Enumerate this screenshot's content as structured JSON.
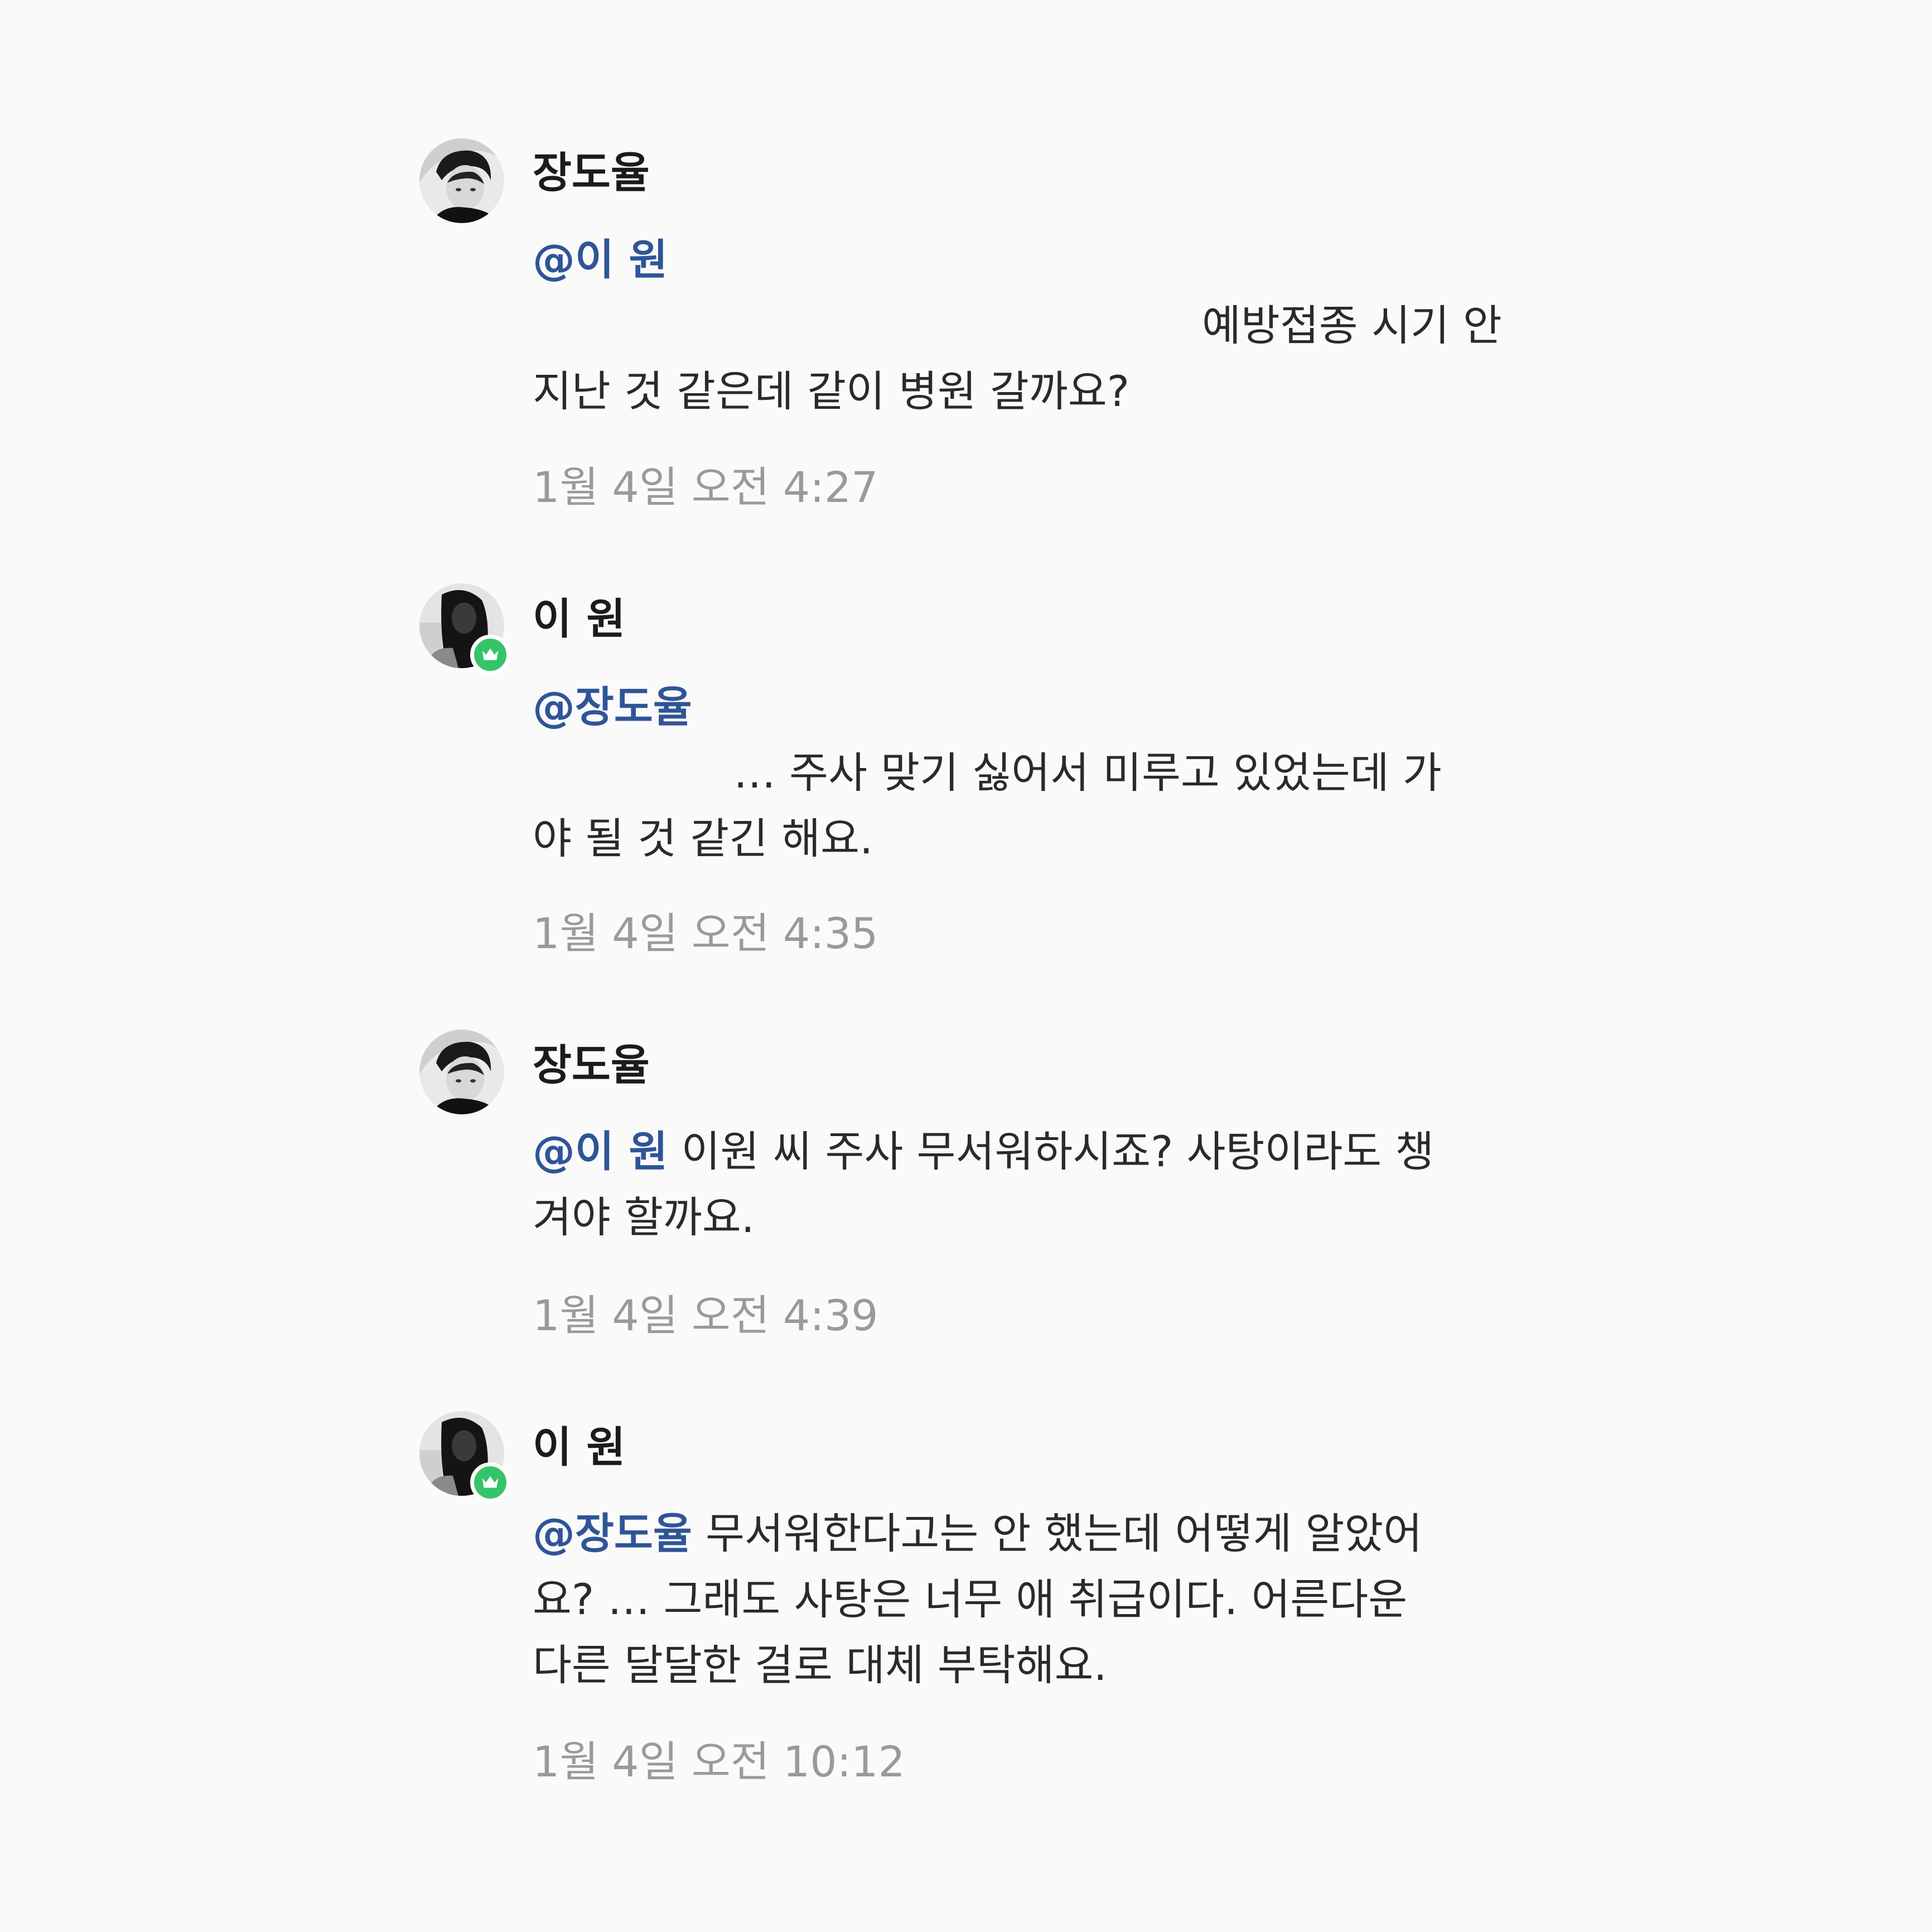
{
  "messages": [
    {
      "sender": "장도율",
      "mention": "@이 원",
      "line1": "예방접종 시기 안",
      "line2": "지난 것 같은데 같이 병원 갈까요?",
      "time": "1월 4일 오전 4:27",
      "badge": false
    },
    {
      "sender": "이 원",
      "mention": "@장도율",
      "line1": "… 주사 맞기 싫어서 미루고 있었는데 가",
      "line2": "야 될 것 같긴 해요.",
      "time": "1월 4일 오전 4:35",
      "badge": true
    },
    {
      "sender": "장도율",
      "mention": "@이 원",
      "line1": "이원 씨 주사 무서워하시죠? 사탕이라도 챙",
      "line2": "겨야 할까요.",
      "time": "1월 4일 오전 4:39",
      "badge": false
    },
    {
      "sender": "이 원",
      "mention": "@장도율",
      "line1": "무서워한다고는 안 했는데 어떻게 알았어",
      "line2": "요? … 그래도 사탕은 너무 애 취급이다. 어른다운",
      "line3": "다른 달달한 걸로 대체 부탁해요.",
      "time": "1월 4일 오전 10:12",
      "badge": true
    }
  ],
  "icons": {
    "avatar_male": "profile-photo-man",
    "avatar_female": "profile-photo-woman",
    "badge": "crown-icon"
  },
  "colors": {
    "background": "#fafafa",
    "mention": "#2f5597",
    "timestamp": "#9a9a9a",
    "badge": "#35c46a"
  }
}
